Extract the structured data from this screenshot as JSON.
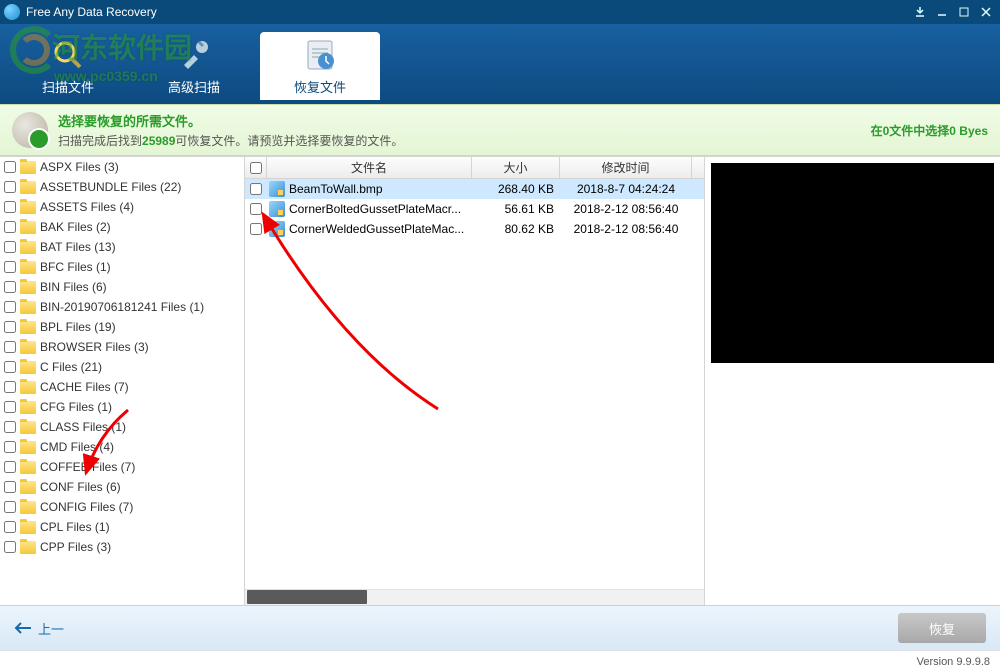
{
  "titlebar": {
    "title": "Free Any Data Recovery"
  },
  "watermark": {
    "text": "河东软件园",
    "url": "www.pc0359.cn"
  },
  "tabs": {
    "scan": "扫描文件",
    "advanced": "高级扫描",
    "recover": "恢复文件"
  },
  "status": {
    "line1": "选择要恢复的所需文件。",
    "line2_a": "扫描完成后找到",
    "line2_num": "25989",
    "line2_b": "可恢复文件。请预览并选择要恢复的文件。",
    "right": "在0文件中选择0 Byes"
  },
  "tree": [
    "ASPX Files (3)",
    "ASSETBUNDLE Files (22)",
    "ASSETS Files (4)",
    "BAK Files (2)",
    "BAT Files (13)",
    "BFC Files (1)",
    "BIN Files (6)",
    "BIN-20190706181241 Files (1)",
    "BPL Files (19)",
    "BROWSER Files (3)",
    "C Files (21)",
    "CACHE Files (7)",
    "CFG Files (1)",
    "CLASS Files (1)",
    "CMD Files (4)",
    "COFFEE Files (7)",
    "CONF Files (6)",
    "CONFIG Files (7)",
    "CPL Files (1)",
    "CPP Files (3)"
  ],
  "columns": {
    "name": "文件名",
    "size": "大小",
    "date": "修改时间"
  },
  "files": [
    {
      "name": "BeamToWall.bmp",
      "size": "268.40 KB",
      "date": "2018-8-7 04:24:24",
      "sel": true
    },
    {
      "name": "CornerBoltedGussetPlateMacr...",
      "size": "56.61 KB",
      "date": "2018-2-12 08:56:40",
      "sel": false
    },
    {
      "name": "CornerWeldedGussetPlateMac...",
      "size": "80.62 KB",
      "date": "2018-2-12 08:56:40",
      "sel": false
    }
  ],
  "footer": {
    "prev": "上一",
    "recover": "恢复"
  },
  "version": "Version 9.9.9.8"
}
